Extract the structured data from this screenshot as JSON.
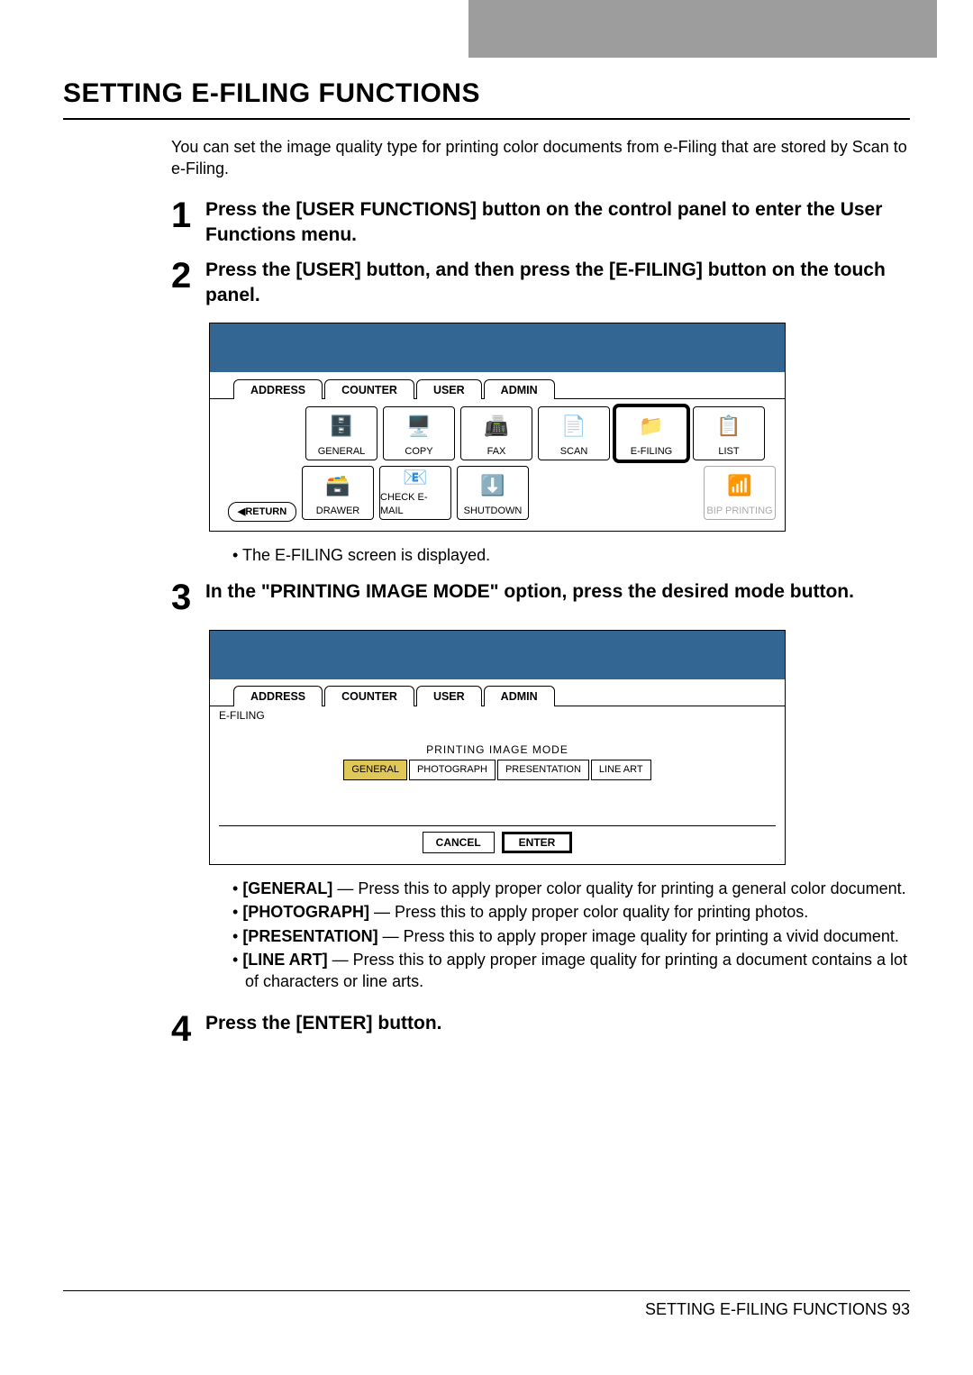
{
  "page": {
    "title": "SETTING E-FILING FUNCTIONS",
    "intro": "You can set the image quality type for printing color documents from e-Filing that are stored by Scan to e-Filing.",
    "footer": "SETTING E-FILING FUNCTIONS    93"
  },
  "steps": {
    "s1": {
      "num": "1",
      "text": "Press the [USER FUNCTIONS] button on the control panel to enter the User Functions menu."
    },
    "s2": {
      "num": "2",
      "text": "Press the [USER] button, and then press the [E-FILING] button on the touch panel."
    },
    "s2_note": "The E-FILING screen is displayed.",
    "s3": {
      "num": "3",
      "text": "In the \"PRINTING IMAGE MODE\" option, press the desired mode button."
    },
    "s4": {
      "num": "4",
      "text": "Press the [ENTER] button."
    }
  },
  "screen1": {
    "tabs": {
      "address": "ADDRESS",
      "counter": "COUNTER",
      "user": "USER",
      "admin": "ADMIN"
    },
    "row1": {
      "general": "GENERAL",
      "copy": "COPY",
      "fax": "FAX",
      "scan": "SCAN",
      "efiling": "E-FILING",
      "list": "LIST"
    },
    "row2": {
      "drawer": "DRAWER",
      "checkemail": "CHECK E-MAIL",
      "shutdown": "SHUTDOWN",
      "bip": "BIP PRINTING"
    },
    "return": "RETURN"
  },
  "screen2": {
    "tabs": {
      "address": "ADDRESS",
      "counter": "COUNTER",
      "user": "USER",
      "admin": "ADMIN"
    },
    "sublabel": "E-FILING",
    "modeLabel": "PRINTING IMAGE MODE",
    "modes": {
      "general": "GENERAL",
      "photograph": "PHOTOGRAPH",
      "presentation": "PRESENTATION",
      "lineart": "LINE ART"
    },
    "cancel": "CANCEL",
    "enter": "ENTER"
  },
  "options": {
    "o1_label": "[GENERAL]",
    "o1_text": " — Press this to apply proper color quality for printing a general color document.",
    "o2_label": "[PHOTOGRAPH]",
    "o2_text": " — Press this to apply proper color quality for printing photos.",
    "o3_label": "[PRESENTATION]",
    "o3_text": " — Press this to apply proper image quality for printing a vivid document.",
    "o4_label": "[LINE ART]",
    "o4_text": " — Press this to apply proper image quality for printing a document contains a lot of characters or line arts."
  }
}
